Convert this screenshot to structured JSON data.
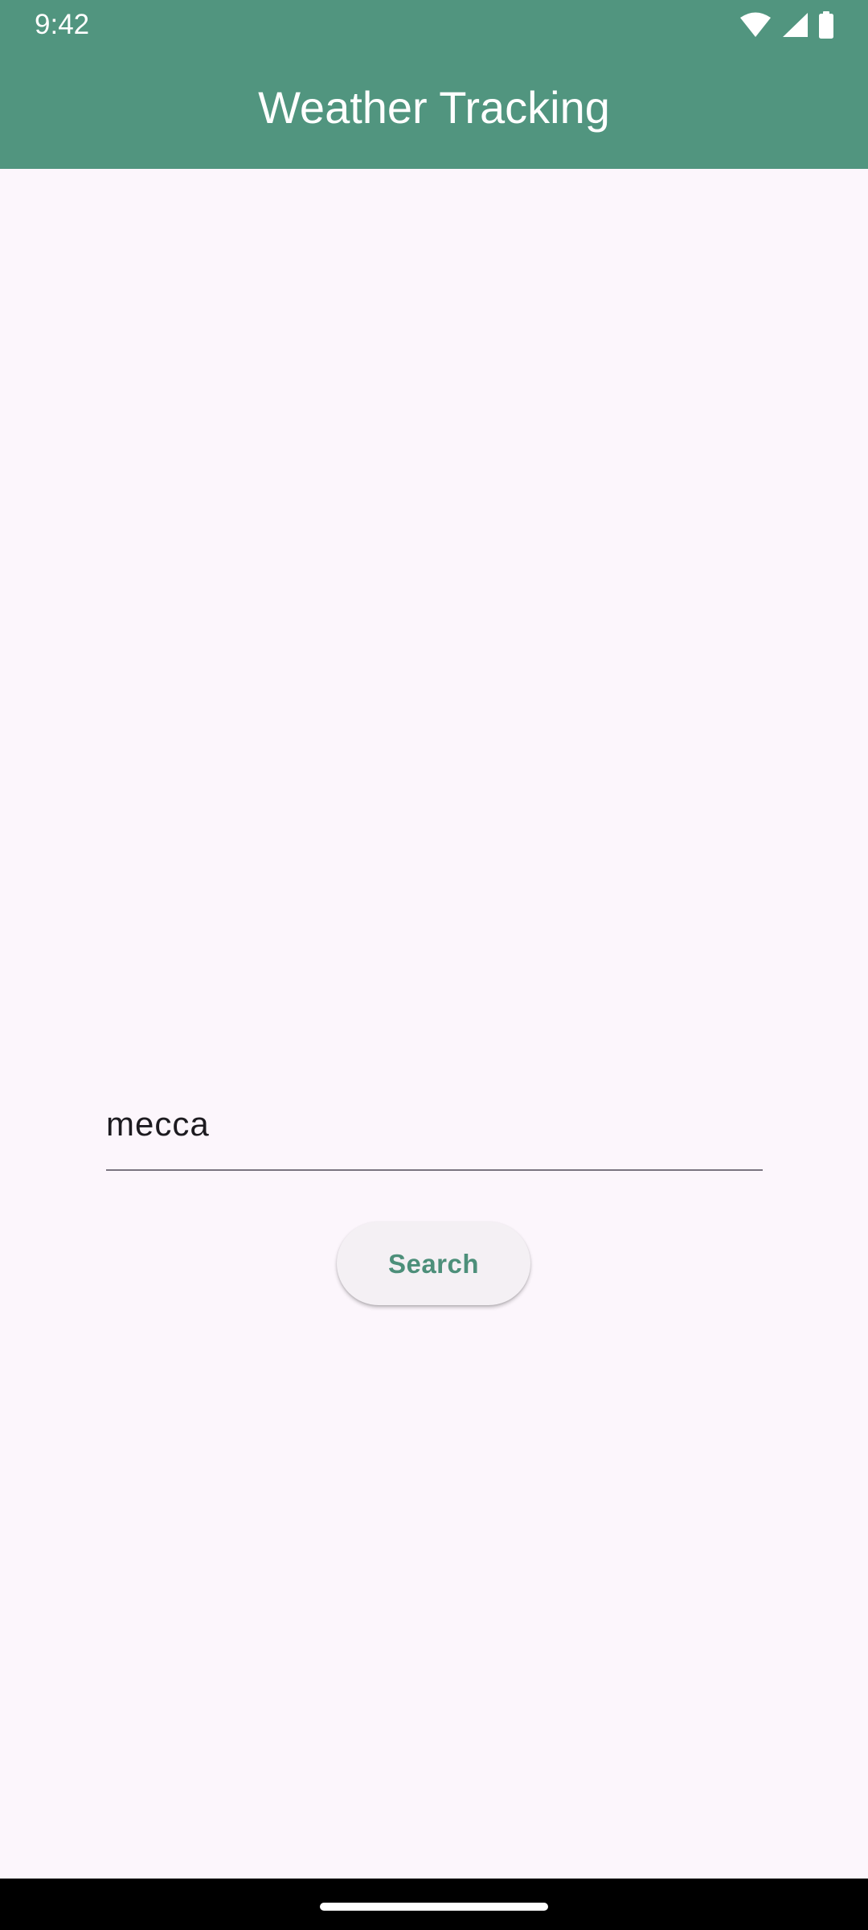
{
  "status_bar": {
    "time": "9:42",
    "icons": [
      "wifi-icon",
      "cellular-signal-icon",
      "battery-icon"
    ]
  },
  "app_bar": {
    "title": "Weather Tracking",
    "background_color": "#51957F"
  },
  "search_form": {
    "city_input_value": "mecca",
    "search_button_label": "Search",
    "accent_color": "#4D8F7A"
  }
}
